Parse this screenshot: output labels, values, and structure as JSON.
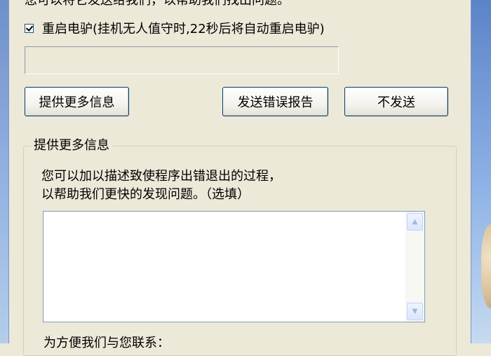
{
  "dialog": {
    "clipped_text": "您可以将它发送给我们，以帮助我们找出问题。",
    "restart_checkbox": {
      "checked": true,
      "label": "重启电驴(挂机无人值守时,22秒后将自动重启电驴)"
    },
    "progress_value": 0,
    "buttons": {
      "more_info": "提供更多信息",
      "send_report": "发送错误报告",
      "dont_send": "不发送"
    },
    "more_info_group": {
      "legend": "提供更多信息",
      "desc_line1": "您可以加以描述致使程序出错退出的过程，",
      "desc_line2": "以帮助我们更快的发现问题。（选填）",
      "textarea_value": "",
      "contact_label": "为方便我们与您联系："
    }
  },
  "icons": {
    "scroll_up": "▲",
    "scroll_down": "▼"
  },
  "colors": {
    "dialog_bg": "#ECE9D8",
    "button_border": "#003c74",
    "desktop_blue": "#8eaee0"
  }
}
